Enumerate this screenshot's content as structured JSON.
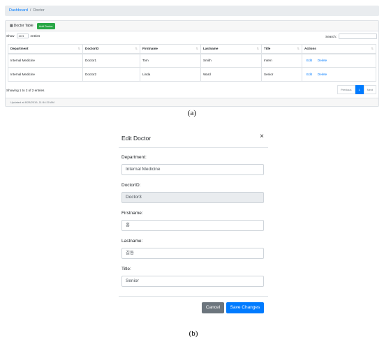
{
  "panel_a": {
    "breadcrumb": {
      "link": "Dashboard",
      "sep": "/",
      "current": "Doctor"
    },
    "header": {
      "title": "Doctor Table",
      "add_button": "Add Doctor"
    },
    "controls": {
      "show": "Show",
      "entries_value": "10",
      "entries": "entries",
      "search": "Search:"
    },
    "table": {
      "headers": [
        "Department",
        "DoctorID",
        "Firstname",
        "Lastname",
        "Title",
        "Actions"
      ],
      "rows": [
        [
          "Internal Medicine",
          "Doctor1",
          "Tom",
          "Smith",
          "Intern"
        ],
        [
          "Internal Medicine",
          "Doctor2",
          "Linda",
          "Ward",
          "Senior"
        ]
      ],
      "edit": "Edit",
      "delete": "Delete"
    },
    "info": "Showing 1 to 2 of 2 entries",
    "pagination": {
      "prev": "Previous",
      "page": "1",
      "next": "Next"
    },
    "footer": "Updated at 8/28/2019, 11:54:20 AM",
    "caption": "(a)"
  },
  "panel_b": {
    "title": "Edit Doctor",
    "close": "×",
    "fields": [
      {
        "label": "Department:",
        "value": "Internal Medicine"
      },
      {
        "label": "DoctorID:",
        "value": "Doctor3"
      },
      {
        "label": "Firstname:",
        "value": "홍"
      },
      {
        "label": "Lastname:",
        "value": "길동"
      },
      {
        "label": "Title:",
        "value": "Senior"
      }
    ],
    "cancel": "Cancel",
    "save": "Save Changes",
    "caption": "(b)"
  },
  "colors": {
    "primary": "#007bff",
    "success": "#28a745",
    "secondary": "#6c757d"
  }
}
